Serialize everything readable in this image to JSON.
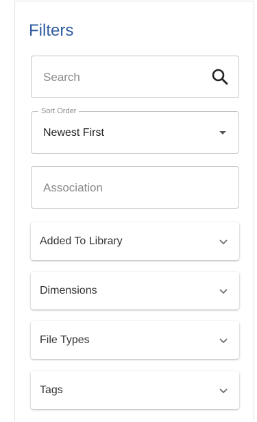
{
  "filters": {
    "title": "Filters",
    "search": {
      "placeholder": "Search",
      "icon": "search-icon"
    },
    "sort_order": {
      "legend": "Sort Order",
      "value": "Newest First",
      "icon": "caret-down-icon"
    },
    "association": {
      "placeholder": "Association"
    },
    "sections": [
      {
        "label": "Added To Library",
        "icon": "chevron-down-icon"
      },
      {
        "label": "Dimensions",
        "icon": "chevron-down-icon"
      },
      {
        "label": "File Types",
        "icon": "chevron-down-icon"
      },
      {
        "label": "Tags",
        "icon": "chevron-down-icon"
      }
    ]
  },
  "colors": {
    "title": "#2f5d9e",
    "border": "#c4c4c4",
    "placeholder": "#8a8a8a"
  }
}
